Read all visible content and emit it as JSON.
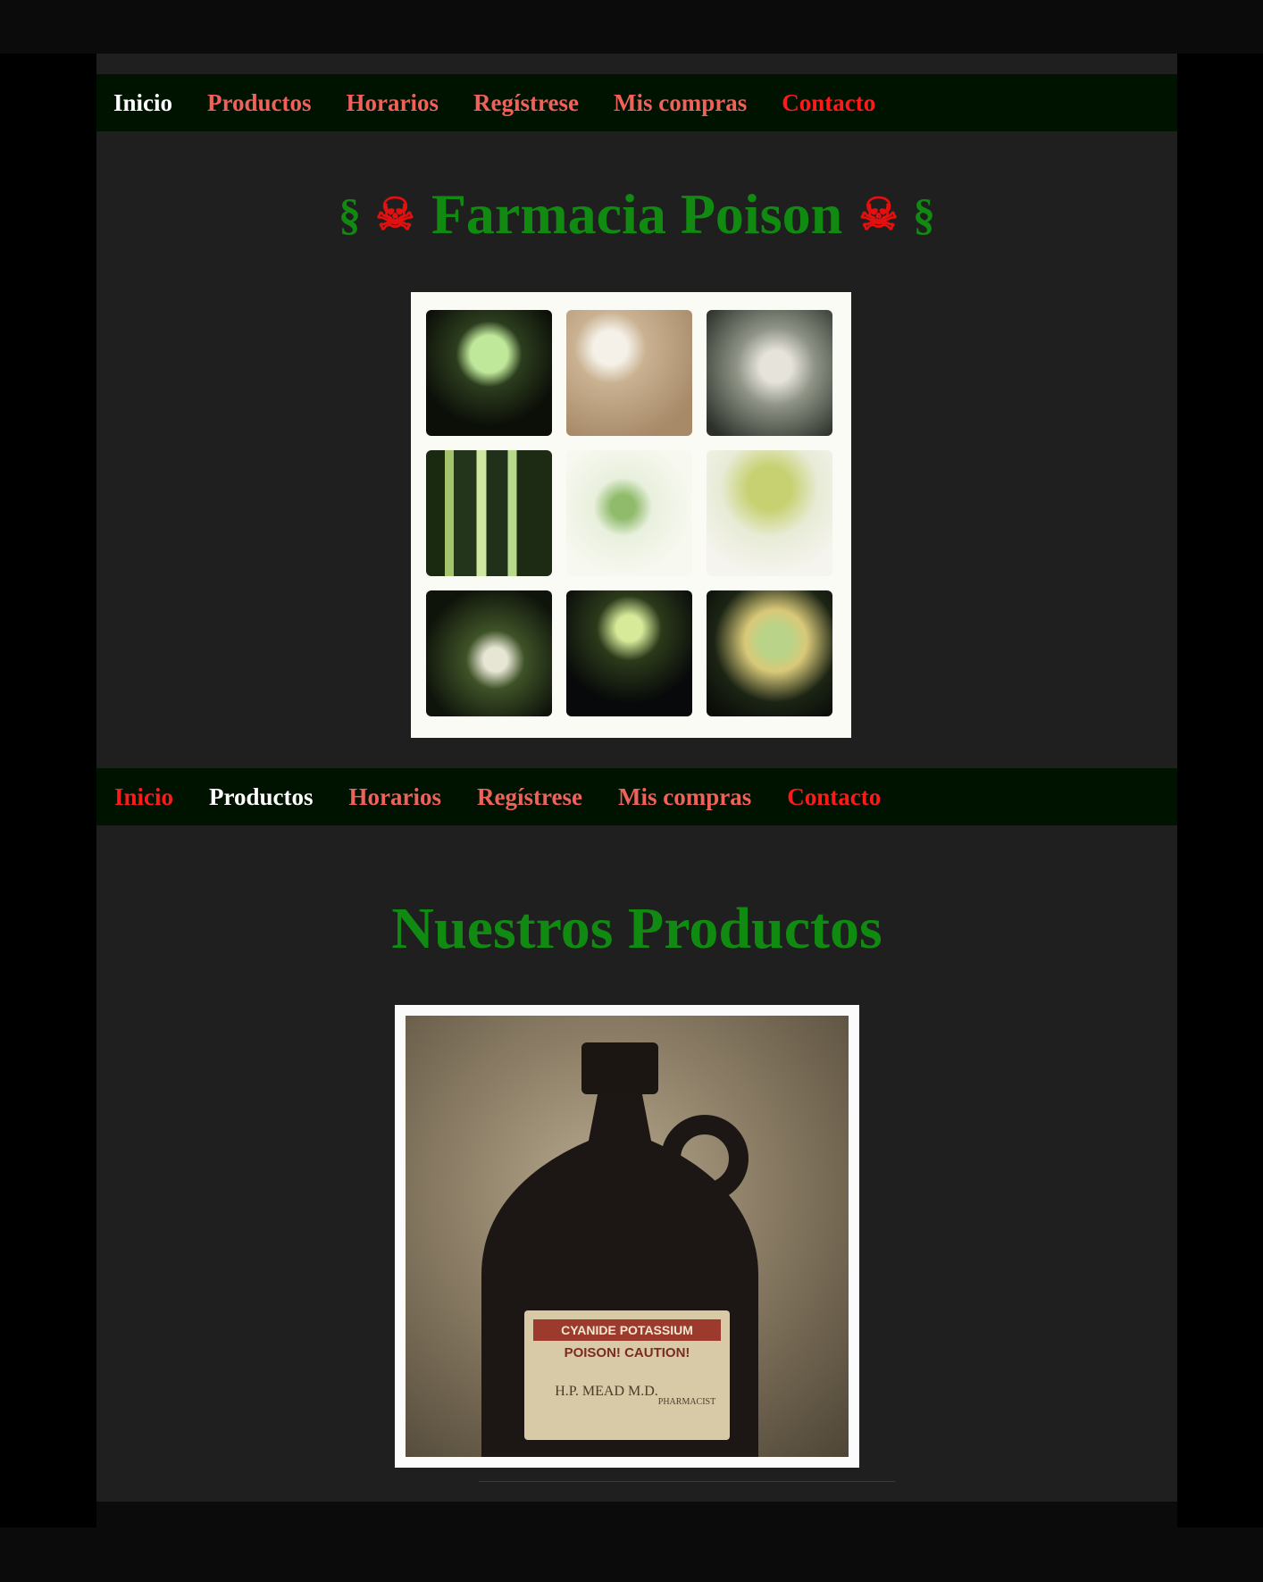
{
  "nav_top": {
    "items": [
      {
        "label": "Inicio",
        "color": "#ffffff"
      },
      {
        "label": "Productos",
        "color": "#f0615a"
      },
      {
        "label": "Horarios",
        "color": "#f0615a"
      },
      {
        "label": "Regístrese",
        "color": "#f0615a"
      },
      {
        "label": "Mis compras",
        "color": "#f0615a"
      },
      {
        "label": "Contacto",
        "color": "#ff1a1a"
      }
    ]
  },
  "header": {
    "title": "Farmacia Poison",
    "icons": [
      "caduceus-icon",
      "skull-crossbones-icon"
    ],
    "title_color": "#118a11"
  },
  "nav_bottom": {
    "items": [
      {
        "label": "Inicio",
        "color": "#ff1a1a"
      },
      {
        "label": "Productos",
        "color": "#ffffff"
      },
      {
        "label": "Horarios",
        "color": "#f0615a"
      },
      {
        "label": "Regístrese",
        "color": "#f0615a"
      },
      {
        "label": "Mis compras",
        "color": "#f0615a"
      },
      {
        "label": "Contacto",
        "color": "#ff1a1a"
      }
    ]
  },
  "products": {
    "heading": "Nuestros Productos",
    "image_label_lines": [
      "CYANIDE POTASSIUM",
      "POISON! CAUTION!",
      "H.P. MEAD M.D.",
      "PHARMACIST"
    ]
  }
}
